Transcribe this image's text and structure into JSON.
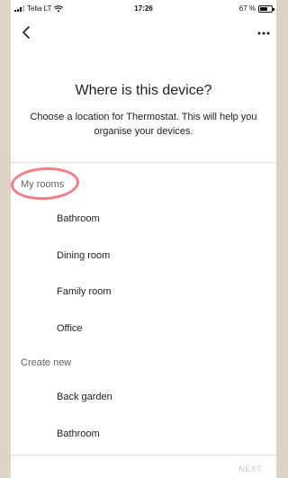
{
  "status_bar": {
    "carrier": "Telia LT",
    "time": "17:26",
    "battery_text": "67 %",
    "battery_level": 0.67
  },
  "header": {
    "back_icon": "chevron-left-icon",
    "more_icon": "more-horizontal-icon"
  },
  "title": "Where is this device?",
  "subtitle": "Choose a location for Thermostat. This will help you organise your devices.",
  "sections": {
    "my_rooms": {
      "label": "My rooms",
      "items": [
        "Bathroom",
        "Dining room",
        "Family room",
        "Office"
      ]
    },
    "create_new": {
      "label": "Create new",
      "items": [
        "Back garden",
        "Bathroom"
      ]
    }
  },
  "footer": {
    "next_label": "NEXT"
  },
  "annotation_color": "#ef7f86"
}
